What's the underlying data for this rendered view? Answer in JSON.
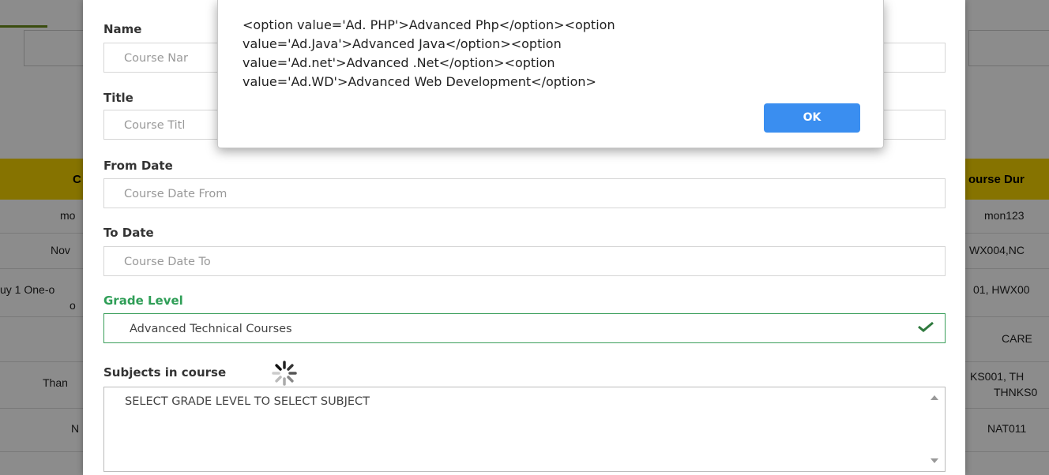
{
  "background_table": {
    "header_left": "C",
    "header_right": "ourse Dur",
    "rows": [
      {
        "left": "mo",
        "right": "mon123"
      },
      {
        "left": "Nov",
        "right": "WX004,NC"
      },
      {
        "left": "uy 1 One-o",
        "left2": "o",
        "right": "01, HWX00"
      },
      {
        "left": "",
        "right": "CARE"
      },
      {
        "left": "Than",
        "right": "KS001, TH",
        "right2": "THNKS0"
      },
      {
        "left": "N",
        "right": "NAT011"
      }
    ]
  },
  "form": {
    "name_label": "Name",
    "name_placeholder": "Course Nar",
    "title_label": "Title",
    "title_placeholder": "Course Titl",
    "from_date_label": "From Date",
    "from_date_placeholder": "Course Date From",
    "to_date_label": "To Date",
    "to_date_placeholder": "Course Date To",
    "grade_level_label": "Grade Level",
    "grade_level_value": "Advanced Technical Courses",
    "subjects_label": "Subjects in course",
    "subjects_value": "SELECT GRADE LEVEL TO SELECT SUBJECT"
  },
  "alert": {
    "lines": [
      "<option value='Ad. PHP'>Advanced Php</option><option",
      "value='Ad.Java'>Advanced Java</option><option",
      "value='Ad.net'>Advanced .Net</option><option",
      "value='Ad.WD'>Advanced Web Development</option>"
    ],
    "ok_label": "OK"
  },
  "colors": {
    "accent_green": "#2f9e57",
    "ok_blue": "#3a8ef0",
    "header_yellow": "#f5d200"
  }
}
